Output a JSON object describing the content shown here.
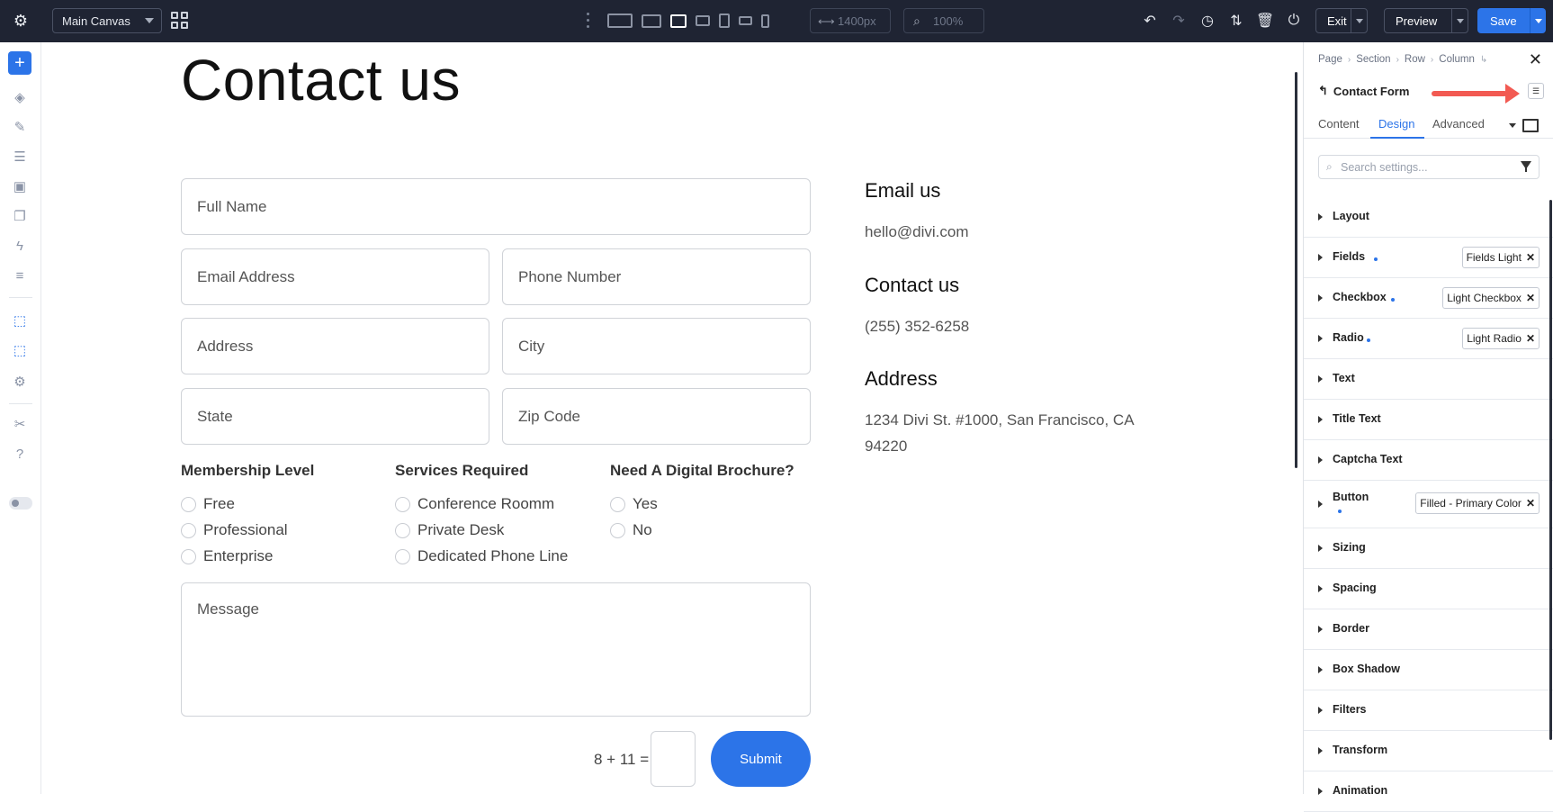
{
  "topbar": {
    "canvas_select": "Main Canvas",
    "width_value": "1400px",
    "zoom_value": "100%",
    "exit_label": "Exit",
    "preview_label": "Preview",
    "save_label": "Save"
  },
  "page": {
    "title": "Contact us",
    "fields": {
      "full_name": "Full Name",
      "email": "Email Address",
      "phone": "Phone Number",
      "address": "Address",
      "city": "City",
      "state": "State",
      "zip": "Zip Code",
      "message": "Message"
    },
    "groups": {
      "membership": {
        "title": "Membership Level",
        "options": [
          "Free",
          "Professional",
          "Enterprise"
        ]
      },
      "services": {
        "title": "Services Required",
        "options": [
          "Conference Roomm",
          "Private Desk",
          "Dedicated Phone Line"
        ]
      },
      "brochure": {
        "title": "Need A Digital Brochure?",
        "options": [
          "Yes",
          "No"
        ]
      }
    },
    "captcha": "8 + 11 =",
    "submit_label": "Submit",
    "info": {
      "email_heading": "Email us",
      "email_value": "hello@divi.com",
      "contact_heading": "Contact us",
      "contact_value": "(255) 352-6258",
      "address_heading": "Address",
      "address_line1": "1234 Divi St. #1000, San Francisco, CA",
      "address_line2": "94220"
    }
  },
  "panel": {
    "breadcrumb": [
      "Page",
      "Section",
      "Row",
      "Column"
    ],
    "module_title": "Contact Form",
    "tabs": [
      "Content",
      "Design",
      "Advanced"
    ],
    "active_tab": "Design",
    "search_placeholder": "Search settings...",
    "sections": [
      {
        "label": "Layout"
      },
      {
        "label": "Fields",
        "badge": "Fields Light"
      },
      {
        "label": "Checkbox",
        "badge": "Light Checkbox"
      },
      {
        "label": "Radio",
        "badge": "Light Radio"
      },
      {
        "label": "Text"
      },
      {
        "label": "Title Text"
      },
      {
        "label": "Captcha Text"
      },
      {
        "label": "Button",
        "badge": "Filled - Primary Color"
      },
      {
        "label": "Sizing"
      },
      {
        "label": "Spacing"
      },
      {
        "label": "Border"
      },
      {
        "label": "Box Shadow"
      },
      {
        "label": "Filters"
      },
      {
        "label": "Transform"
      },
      {
        "label": "Animation"
      }
    ]
  },
  "colors": {
    "accent": "#2c74e8",
    "topbar": "#1f2433",
    "annotation_arrow": "#f25a52"
  }
}
